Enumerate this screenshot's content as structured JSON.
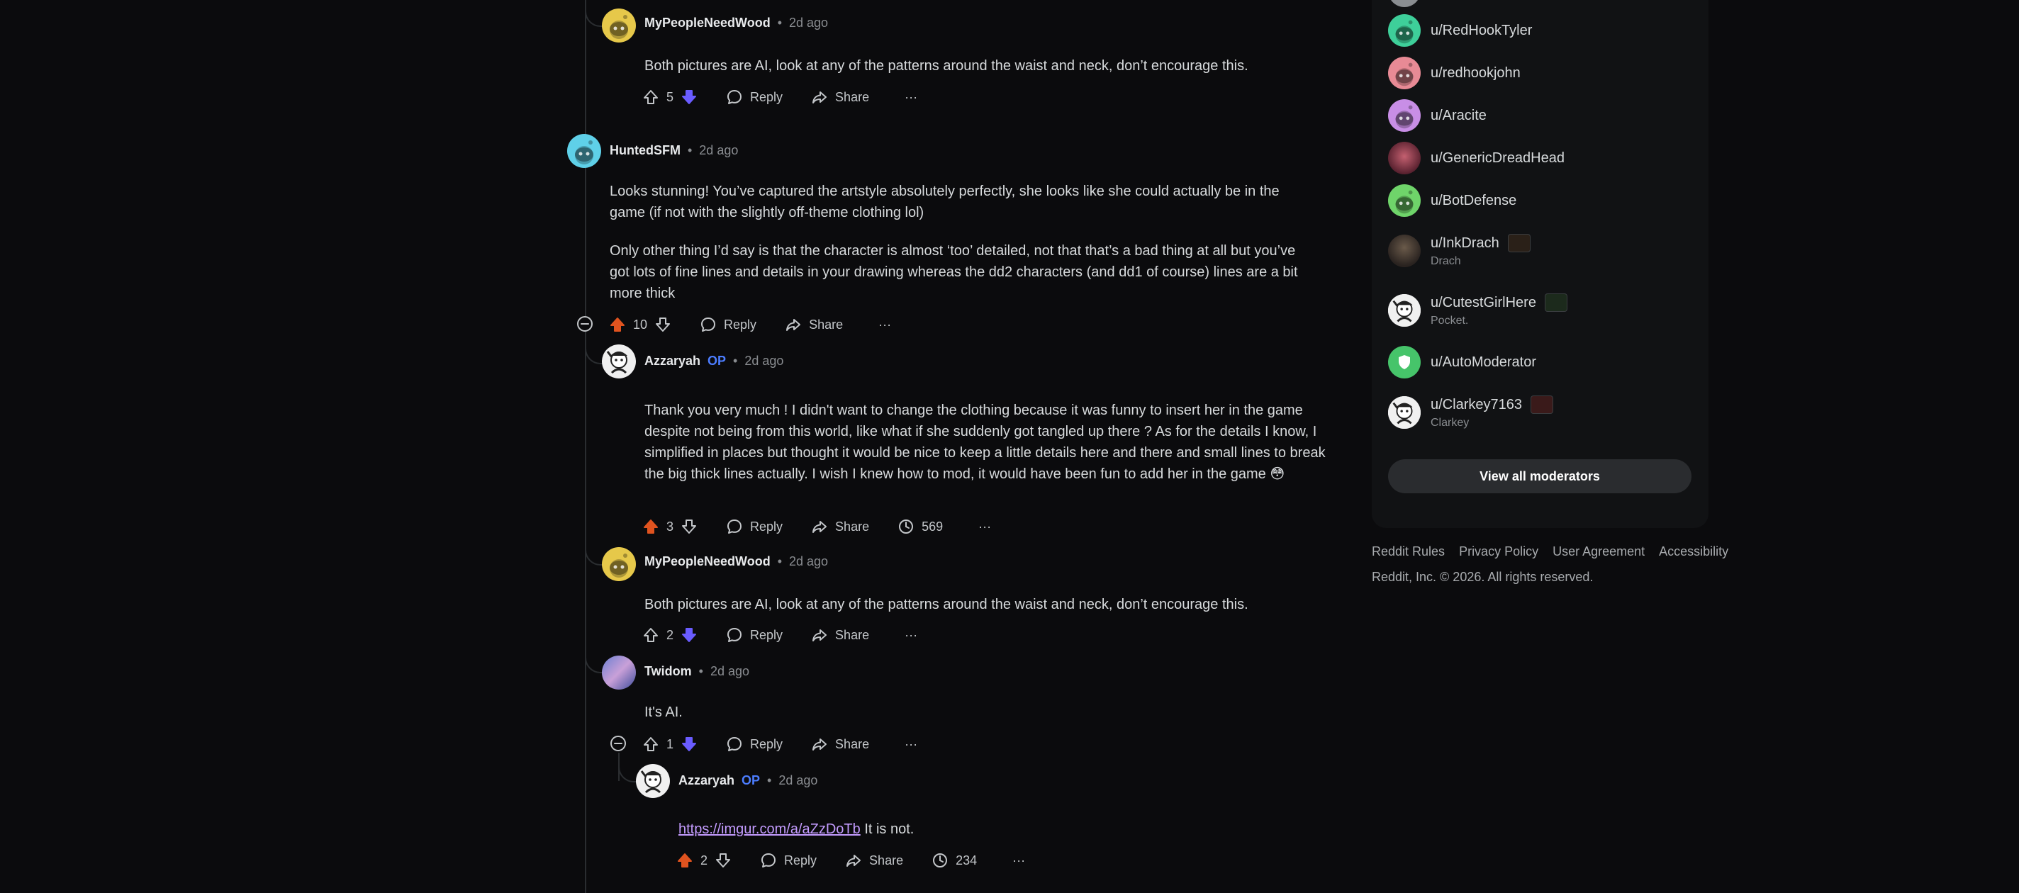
{
  "comments": [
    {
      "author": "MyPeopleNeedWood",
      "time": "2d ago",
      "body": [
        "Both pictures are AI, look at any of the patterns around the waist and neck, don’t encourage this."
      ],
      "votes": "5",
      "reply": "Reply",
      "share": "Share",
      "more": "···"
    },
    {
      "author": "HuntedSFM",
      "time": "2d ago",
      "body": [
        "Looks stunning! You’ve captured the artstyle absolutely perfectly, she looks like she could actually be in the game (if not with the slightly off-theme clothing lol)",
        "Only other thing I’d say is that the character is almost ‘too’ detailed, not that that’s a bad thing at all but you’ve got lots of fine lines and details in your drawing whereas the dd2 characters (and dd1 of course) lines are a bit more thick"
      ],
      "votes": "10",
      "reply": "Reply",
      "share": "Share",
      "more": "···"
    },
    {
      "author": "Azzaryah",
      "op": "OP",
      "time": "2d ago",
      "body": [
        "Thank you very much ! I didn't want to change the clothing because it was funny to insert her in the game despite not being from this world, like what if she suddenly got tangled up there ? As for the details I know, I simplified in places but thought it would be nice to keep a little details here and there and small lines to break the big thick lines actually. I wish I knew how to mod, it would have been fun to add her in the game 😳"
      ],
      "votes": "3",
      "reply": "Reply",
      "share": "Share",
      "views": "569",
      "more": "···"
    },
    {
      "author": "MyPeopleNeedWood",
      "time": "2d ago",
      "body": [
        "Both pictures are AI, look at any of the patterns around the waist and neck, don’t encourage this."
      ],
      "votes": "2",
      "reply": "Reply",
      "share": "Share",
      "more": "···"
    },
    {
      "author": "Twidom",
      "time": "2d ago",
      "body": [
        "It's AI."
      ],
      "votes": "1",
      "reply": "Reply",
      "share": "Share",
      "more": "···"
    },
    {
      "author": "Azzaryah",
      "op": "OP",
      "time": "2d ago",
      "link": "https://imgur.com/a/aZzDoTb",
      "body_after_link": " It is not.",
      "votes": "2",
      "reply": "Reply",
      "share": "Share",
      "views": "234",
      "more": "···"
    }
  ],
  "separator": "•",
  "moderators": [
    {
      "name": "u/RedHookTyler",
      "flair": ""
    },
    {
      "name": "u/redhookjohn",
      "flair": ""
    },
    {
      "name": "u/Aracite",
      "flair": ""
    },
    {
      "name": "u/GenericDreadHead",
      "flair": ""
    },
    {
      "name": "u/BotDefense",
      "flair": ""
    },
    {
      "name": "u/InkDrach",
      "flair": "Drach"
    },
    {
      "name": "u/CutestGirlHere",
      "flair": "Pocket."
    },
    {
      "name": "u/AutoModerator",
      "flair": ""
    },
    {
      "name": "u/Clarkey7163",
      "flair": "Clarkey"
    }
  ],
  "view_all_moderators": "View all moderators",
  "footer": {
    "links": [
      "Reddit Rules",
      "Privacy Policy",
      "User Agreement",
      "Accessibility"
    ],
    "copyright": "Reddit, Inc. © 2026. All rights reserved."
  },
  "colors": {
    "upvote_active": "#e0531f",
    "downvote_active": "#6a5cff",
    "op": "#4c7dff",
    "link": "#c49cff",
    "background": "#0b0b0d"
  }
}
